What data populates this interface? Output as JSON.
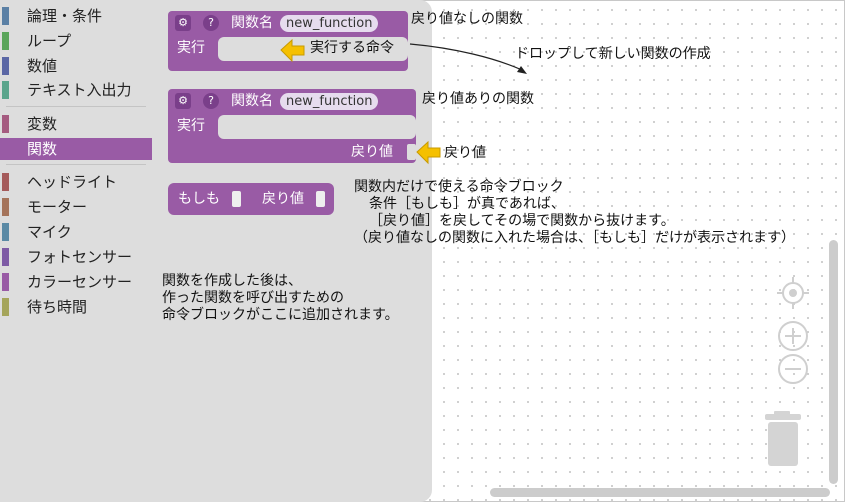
{
  "categories": [
    {
      "label": "論理・条件",
      "color": "#5b80a5",
      "selected": false
    },
    {
      "label": "ループ",
      "color": "#5ba55b",
      "selected": false
    },
    {
      "label": "数値",
      "color": "#5b67a5",
      "selected": false
    },
    {
      "label": "テキスト入出力",
      "color": "#5ba58c",
      "selected": false
    },
    {
      "label": "変数",
      "color": "#a55b80",
      "selected": false
    },
    {
      "label": "関数",
      "color": "#995ba5",
      "selected": true
    },
    {
      "label": "ヘッドライト",
      "color": "#a55b5b",
      "selected": false
    },
    {
      "label": "モーター",
      "color": "#a5745b",
      "selected": false
    },
    {
      "label": "マイク",
      "color": "#5b8aa5",
      "selected": false
    },
    {
      "label": "フォトセンサー",
      "color": "#7e5ba5",
      "selected": false
    },
    {
      "label": "カラーセンサー",
      "color": "#995ba5",
      "selected": false
    },
    {
      "label": "待ち時間",
      "color": "#a5a55b",
      "selected": false
    }
  ],
  "blocks": {
    "func_noreturn": {
      "title": "関数名",
      "name": "new_function",
      "exec": "実行",
      "gear": "⚙",
      "help": "?"
    },
    "func_return": {
      "title": "関数名",
      "name": "new_function",
      "exec": "実行",
      "return": "戻り値",
      "gear": "⚙",
      "help": "?"
    },
    "ifreturn": {
      "if": "もしも",
      "return": "戻り値"
    }
  },
  "annotations": {
    "no_return": "戻り値なしの関数",
    "exec_cmd": "実行する命令",
    "drop_new": "ドロップして新しい関数の作成",
    "with_return": "戻り値ありの関数",
    "return_val": "戻り値",
    "inner_1": "関数内だけで使える命令ブロック",
    "inner_2": "条件［もしも］が真であれば、",
    "inner_3": "［戻り値］を戻してその場で関数から抜けます。",
    "inner_4": "（戻り値なしの関数に入れた場合は、［もしも］だけが表示されます）",
    "after_1": "関数を作成した後は、",
    "after_2": "作った関数を呼び出すための",
    "after_3": "命令ブロックがここに追加されます。"
  },
  "controls": {
    "center": "target-icon",
    "zoom_in": "plus-icon",
    "zoom_out": "minus-icon",
    "trash": "trash-icon"
  },
  "colors": {
    "function_block": "#995ba5",
    "arrow": "#f5c000"
  }
}
